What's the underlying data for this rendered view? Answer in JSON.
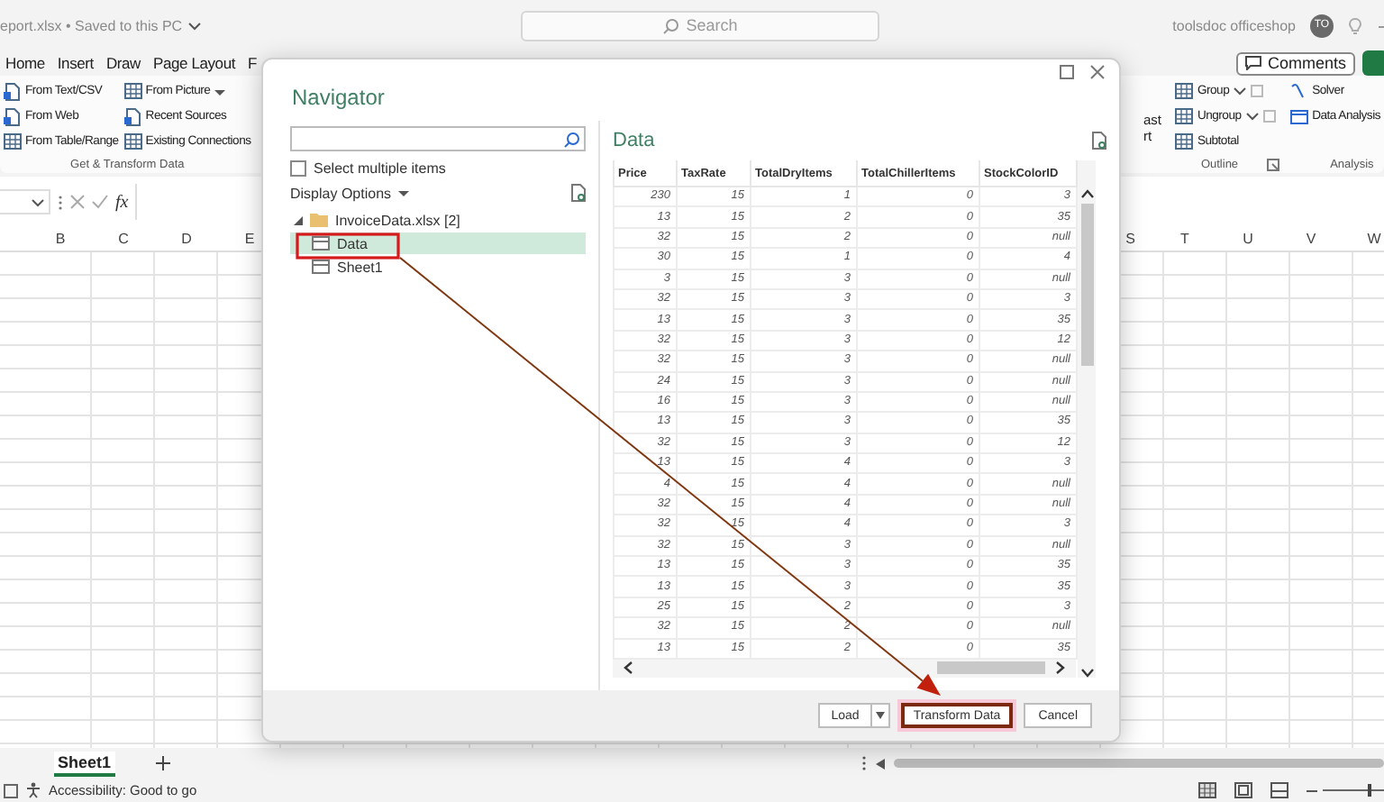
{
  "app": {
    "title": "eport.xlsx • Saved to this PC",
    "search_placeholder": "Search",
    "user": "toolsdoc officeshop",
    "avatar": "TO",
    "comments": "Comments"
  },
  "ribbon_tabs": [
    "Home",
    "Insert",
    "Draw",
    "Page Layout",
    "F"
  ],
  "ribbon_left": {
    "columns": [
      [
        "From Text/CSV",
        "From Web",
        "From Table/Range"
      ],
      [
        "From Picture",
        "Recent Sources",
        "Existing Connections"
      ]
    ],
    "label": "Get & Transform Data"
  },
  "ribbon_right": {
    "fragments": [
      "ast",
      "rt"
    ],
    "outline": {
      "items": [
        "Group",
        "Ungroup",
        "Subtotal"
      ],
      "label": "Outline"
    },
    "analysis": {
      "items": [
        "Solver",
        "Data Analysis"
      ],
      "label": "Analysis"
    }
  },
  "formula_bar": {
    "fx": "fx"
  },
  "columns_left": [
    "B",
    "C",
    "D",
    "E"
  ],
  "columns_right": [
    "S",
    "T",
    "U",
    "V",
    "W"
  ],
  "navigator": {
    "title": "Navigator",
    "select_multiple": {
      "label": "Select multiple items",
      "checked": false
    },
    "display_options": "Display Options",
    "tree": [
      {
        "label": "InvoiceData.xlsx [2]",
        "expanded": true,
        "children": [
          {
            "label": "Data",
            "selected": true
          },
          {
            "label": "Sheet1",
            "selected": false
          }
        ]
      }
    ],
    "preview": {
      "title": "Data",
      "columns": [
        "Price",
        "TaxRate",
        "TotalDryItems",
        "TotalChillerItems",
        "StockColorID"
      ],
      "rows": [
        [
          "230",
          "15",
          "1",
          "0",
          "3"
        ],
        [
          "13",
          "15",
          "2",
          "0",
          "35"
        ],
        [
          "32",
          "15",
          "2",
          "0",
          "null"
        ],
        [
          "30",
          "15",
          "1",
          "0",
          "4"
        ],
        [
          "3",
          "15",
          "3",
          "0",
          "null"
        ],
        [
          "32",
          "15",
          "3",
          "0",
          "3"
        ],
        [
          "13",
          "15",
          "3",
          "0",
          "35"
        ],
        [
          "32",
          "15",
          "3",
          "0",
          "12"
        ],
        [
          "32",
          "15",
          "3",
          "0",
          "null"
        ],
        [
          "24",
          "15",
          "3",
          "0",
          "null"
        ],
        [
          "16",
          "15",
          "3",
          "0",
          "null"
        ],
        [
          "13",
          "15",
          "3",
          "0",
          "35"
        ],
        [
          "32",
          "15",
          "3",
          "0",
          "12"
        ],
        [
          "13",
          "15",
          "4",
          "0",
          "3"
        ],
        [
          "4",
          "15",
          "4",
          "0",
          "null"
        ],
        [
          "32",
          "15",
          "4",
          "0",
          "null"
        ],
        [
          "32",
          "15",
          "4",
          "0",
          "3"
        ],
        [
          "32",
          "15",
          "3",
          "0",
          "null"
        ],
        [
          "13",
          "15",
          "3",
          "0",
          "35"
        ],
        [
          "13",
          "15",
          "3",
          "0",
          "35"
        ],
        [
          "25",
          "15",
          "2",
          "0",
          "3"
        ],
        [
          "32",
          "15",
          "2",
          "0",
          "null"
        ],
        [
          "13",
          "15",
          "2",
          "0",
          "35"
        ]
      ]
    },
    "buttons": [
      {
        "label": "Load",
        "kind": "split"
      },
      {
        "label": "Transform Data",
        "kind": "annotated"
      },
      {
        "label": "Cancel",
        "kind": "plain"
      }
    ]
  },
  "sheet_tabs": [
    {
      "label": "Sheet1",
      "selected": true
    }
  ],
  "status_bar": {
    "text": "Accessibility: Good to go",
    "zoom_slider": {
      "level": 0.75
    }
  }
}
